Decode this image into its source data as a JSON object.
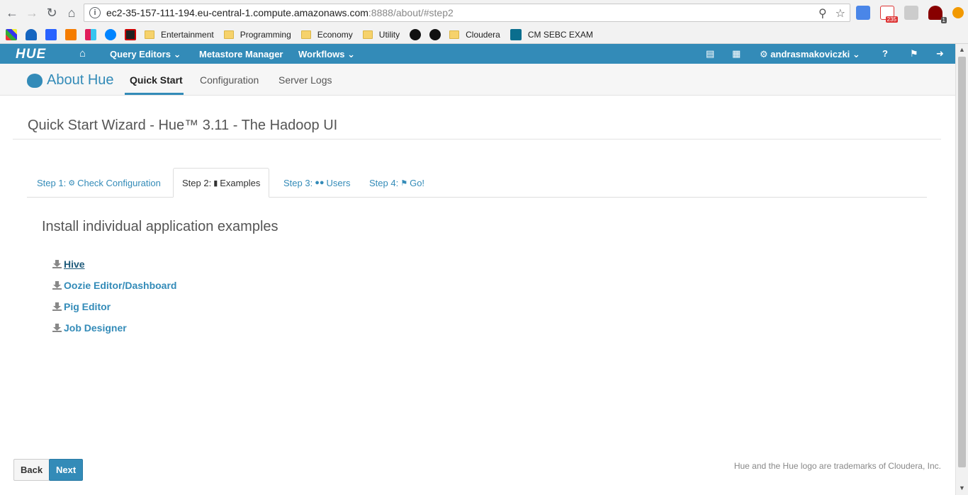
{
  "browser": {
    "url_host": "ec2-35-157-111-194.eu-central-1.compute.amazonaws.com",
    "url_path": ":8888/about/#step2",
    "gmail_badge": "235",
    "ublock_badge": "1",
    "bookmarks": [
      {
        "label": "Entertainment"
      },
      {
        "label": "Programming"
      },
      {
        "label": "Economy"
      },
      {
        "label": "Utility"
      },
      {
        "label": "Cloudera"
      },
      {
        "label": "CM SEBC EXAM"
      }
    ]
  },
  "hue_nav": {
    "logo": "HUE",
    "query_editors": "Query Editors",
    "metastore": "Metastore Manager",
    "workflows": "Workflows",
    "username": "andrasmakoviczki"
  },
  "subheader": {
    "title": "About Hue",
    "tabs": [
      "Quick Start",
      "Configuration",
      "Server Logs"
    ]
  },
  "main": {
    "page_title": "Quick Start Wizard - Hue™ 3.11 - The Hadoop UI",
    "steps": [
      {
        "prefix": "Step 1:",
        "label": "Check Configuration"
      },
      {
        "prefix": "Step 2:",
        "label": "Examples"
      },
      {
        "prefix": "Step 3:",
        "label": "Users"
      },
      {
        "prefix": "Step 4:",
        "label": "Go!"
      }
    ],
    "section_title": "Install individual application examples",
    "examples": [
      "Hive",
      "Oozie Editor/Dashboard",
      "Pig Editor",
      "Job Designer"
    ]
  },
  "footer": {
    "back": "Back",
    "next": "Next",
    "trademark": "Hue and the Hue logo are trademarks of Cloudera, Inc."
  },
  "colors": {
    "accent": "#338bb8"
  }
}
